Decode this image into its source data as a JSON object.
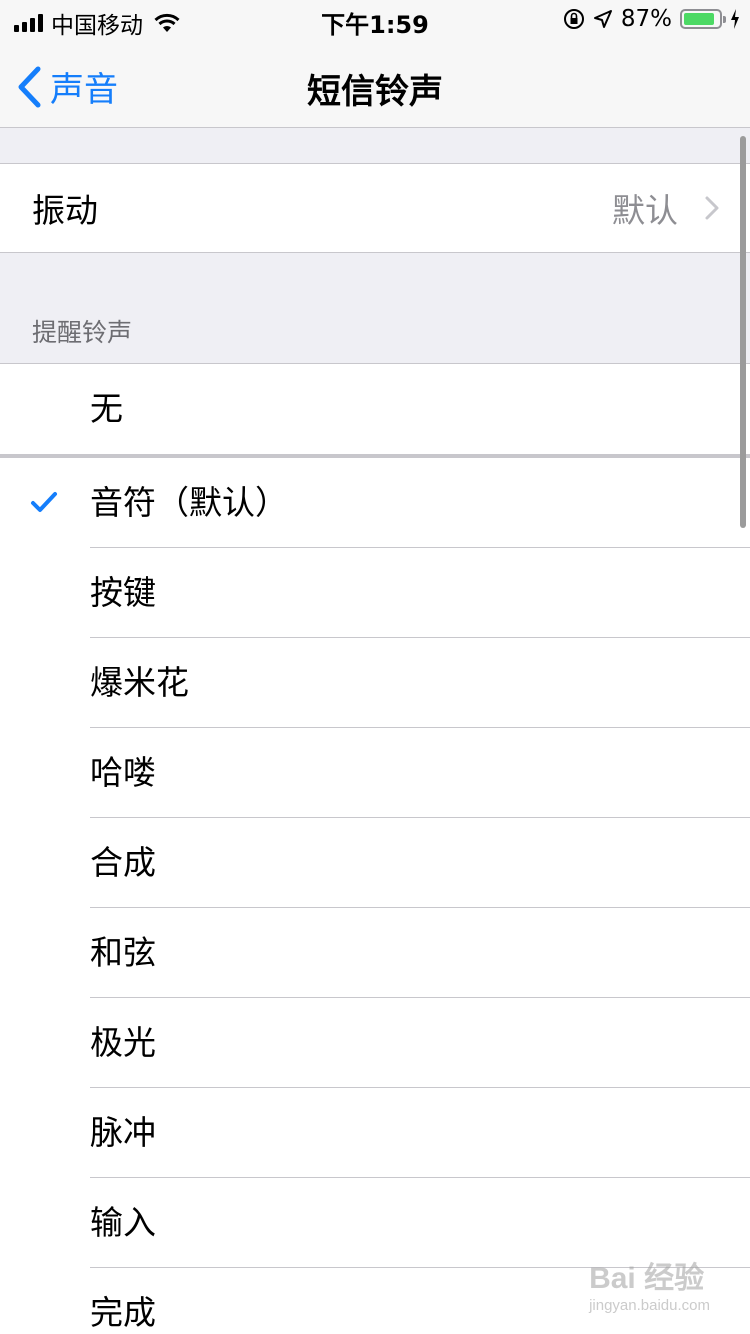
{
  "status": {
    "carrier": "中国移动",
    "time": "下午1:59",
    "battery_percent": "87%",
    "battery_level": 0.87
  },
  "nav": {
    "back_label": "声音",
    "title": "短信铃声"
  },
  "vibration": {
    "label": "振动",
    "value": "默认"
  },
  "alert_section": {
    "header": "提醒铃声",
    "none_label": "无",
    "tones": [
      {
        "label": "音符（默认）",
        "selected": true
      },
      {
        "label": "按键"
      },
      {
        "label": "爆米花"
      },
      {
        "label": "哈喽"
      },
      {
        "label": "合成"
      },
      {
        "label": "和弦"
      },
      {
        "label": "极光"
      },
      {
        "label": "脉冲"
      },
      {
        "label": "输入"
      },
      {
        "label": "完成"
      }
    ]
  },
  "watermark": {
    "text": "Bai 经验",
    "url": "jingyan.baidu.com"
  },
  "colors": {
    "accent": "#157efb",
    "battery": "#4cd964"
  }
}
